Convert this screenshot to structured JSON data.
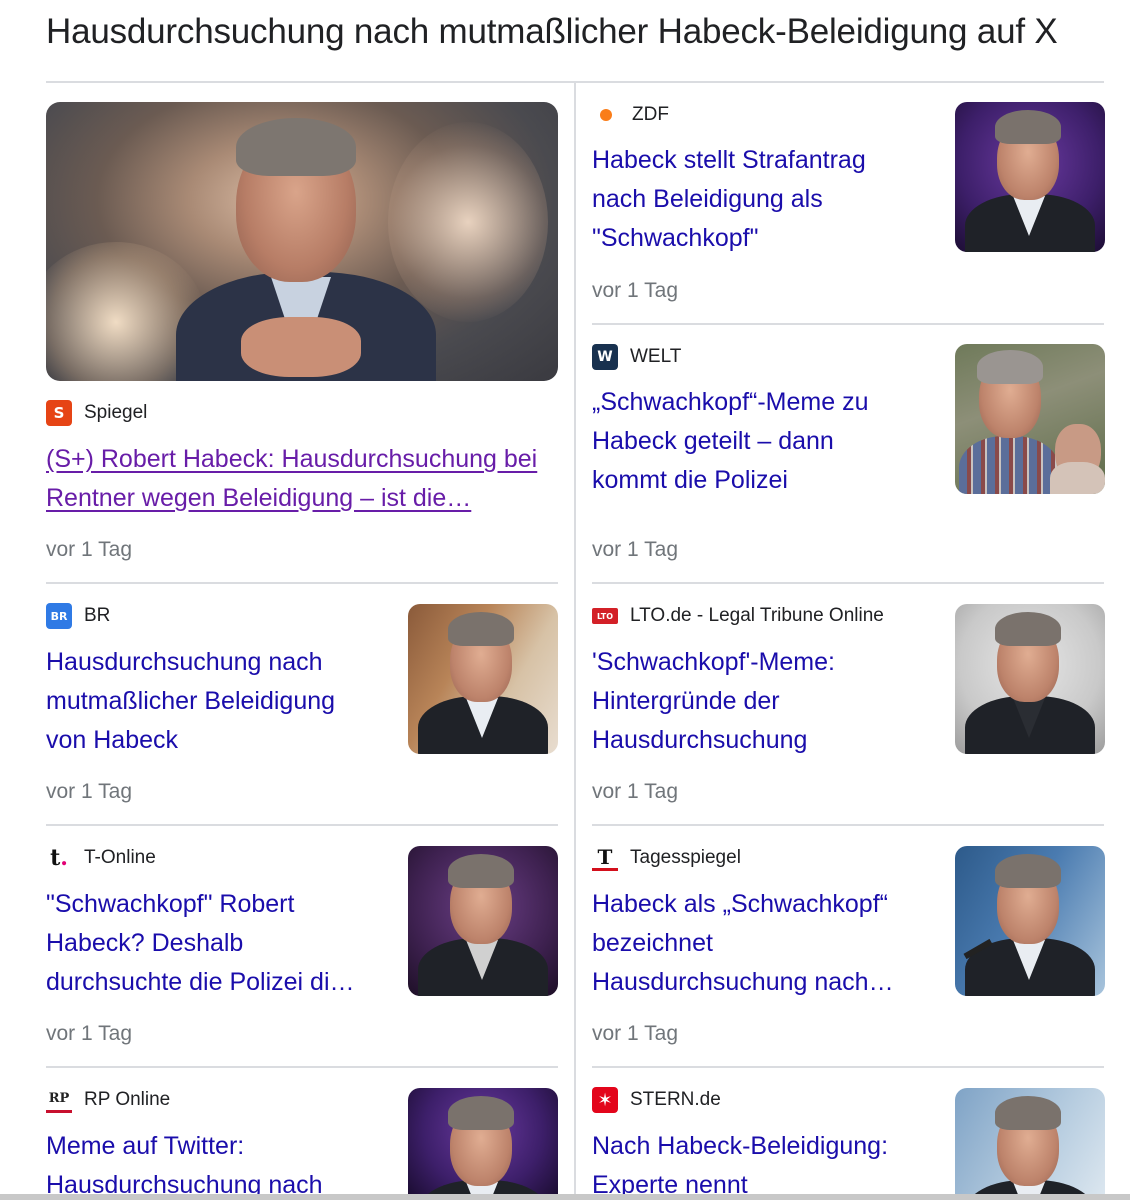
{
  "page": {
    "title": "Hausdurchsuchung nach mutmaßlicher Habeck-Beleidigung auf X"
  },
  "cards": {
    "spiegel": {
      "source": "Spiegel",
      "icon": "spiegel-logo-icon",
      "icon_glyph": "S",
      "icon_color": "#e64415",
      "headline_lines": [
        "(S+) Robert Habeck: Hausdurchsuchung bei",
        "Rentner wegen Beleidigung – ist die…"
      ],
      "time": "vor 1 Tag"
    },
    "zdf": {
      "source": "ZDF",
      "icon": "zdf-logo-icon",
      "icon_glyph": "ZDF",
      "icon_color": "#fa7d19",
      "headline_lines": [
        "Habeck stellt Strafantrag",
        "nach Beleidigung als",
        "\"Schwachkopf\""
      ],
      "time": "vor 1 Tag"
    },
    "welt": {
      "source": "WELT",
      "icon": "welt-logo-icon",
      "icon_glyph": "W",
      "icon_color": "#18314f",
      "headline_lines": [
        "„Schwachkopf“-Meme zu",
        "Habeck geteilt – dann",
        "kommt die Polizei"
      ],
      "time": "vor 1 Tag"
    },
    "br": {
      "source": "BR",
      "icon": "br-logo-icon",
      "icon_glyph": "BR",
      "icon_color": "#2f7ae5",
      "headline_lines": [
        "Hausdurchsuchung nach",
        "mutmaßlicher Beleidigung",
        "von Habeck"
      ],
      "time": "vor 1 Tag"
    },
    "lto": {
      "source": "LTO.de - Legal Tribune Online",
      "icon": "lto-logo-icon",
      "icon_glyph": "LTO",
      "icon_color": "#d32027",
      "headline_lines": [
        "'Schwachkopf'-Meme:",
        "Hintergründe der",
        "Hausdurchsuchung"
      ],
      "time": "vor 1 Tag"
    },
    "tonline": {
      "source": "T-Online",
      "icon": "t-online-logo-icon",
      "icon_glyph": "t.",
      "icon_color": "#e20074",
      "headline_lines": [
        "\"Schwachkopf\" Robert",
        "Habeck? Deshalb",
        "durchsuchte die Polizei di…"
      ],
      "time": "vor 1 Tag"
    },
    "tagesspiegel": {
      "source": "Tagesspiegel",
      "icon": "tagesspiegel-logo-icon",
      "icon_glyph": "T",
      "icon_color": "#d30f1c",
      "headline_lines": [
        "Habeck als „Schwachkopf“",
        "bezeichnet",
        "Hausdurchsuchung nach…"
      ],
      "time": "vor 1 Tag"
    },
    "rp": {
      "source": "RP Online",
      "icon": "rp-online-logo-icon",
      "icon_glyph": "RP",
      "icon_color": "#c8102e",
      "headline_lines": [
        "Meme auf Twitter:",
        "Hausdurchsuchung nach"
      ]
    },
    "stern": {
      "source": "STERN.de",
      "icon": "stern-logo-icon",
      "icon_glyph": "✶",
      "icon_color": "#e3051b",
      "headline_lines": [
        "Nach Habeck-Beleidigung:",
        "Experte nennt"
      ]
    }
  }
}
